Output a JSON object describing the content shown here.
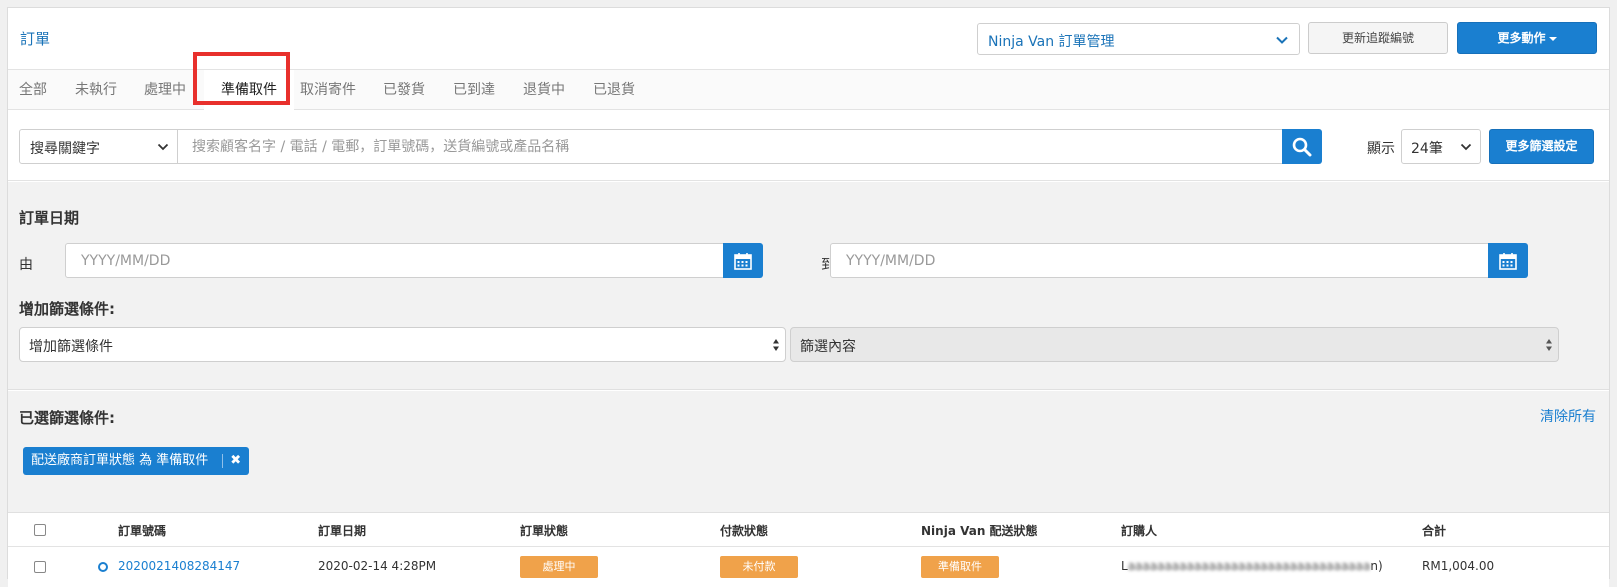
{
  "header": {
    "title": "訂單",
    "mgmt_select_value": "Ninja Van 訂單管理",
    "refresh_button": "更新追蹤編號",
    "more_actions_button": "更多動作"
  },
  "tabs": [
    {
      "label": "全部"
    },
    {
      "label": "未執行"
    },
    {
      "label": "處理中"
    },
    {
      "label": "準備取件",
      "active": true
    },
    {
      "label": "取消寄件"
    },
    {
      "label": "已發貨"
    },
    {
      "label": "已到達"
    },
    {
      "label": "退貨中"
    },
    {
      "label": "已退貨"
    }
  ],
  "search": {
    "keyword_select": "搜尋關鍵字",
    "placeholder": "搜索顧客名字 / 電話 / 電郵，訂單號碼，送貨編號或產品名稱",
    "show_label": "顯示",
    "per_page": "24筆",
    "more_filters_button": "更多篩選設定"
  },
  "filters": {
    "order_date_title": "訂單日期",
    "from_label": "由",
    "to_label": "到",
    "date_placeholder": "YYYY/MM/DD",
    "add_condition_title": "增加篩選條件:",
    "add_condition_select": "增加篩選條件",
    "filter_content_select": "篩選內容"
  },
  "selected": {
    "title": "已選篩選條件:",
    "clear_all": "清除所有",
    "tag": "配送廠商訂單狀態 為 準備取件"
  },
  "table": {
    "columns": [
      "訂單號碼",
      "訂單日期",
      "訂單狀態",
      "付款狀態",
      "Ninja Van 配送狀態",
      "訂購人",
      "合計"
    ],
    "rows": [
      {
        "order_no": "2020021408284147",
        "order_date": "2020-02-14 4:28PM",
        "order_status": "處理中",
        "payment_status": "未付款",
        "delivery_status": "準備取件",
        "customer": "L",
        "customer_suffix": "n)",
        "total": "RM1,004.00"
      }
    ]
  },
  "colors": {
    "accent": "#1a7fd0",
    "badge": "#f0a24a",
    "highlight": "#e8302c"
  }
}
